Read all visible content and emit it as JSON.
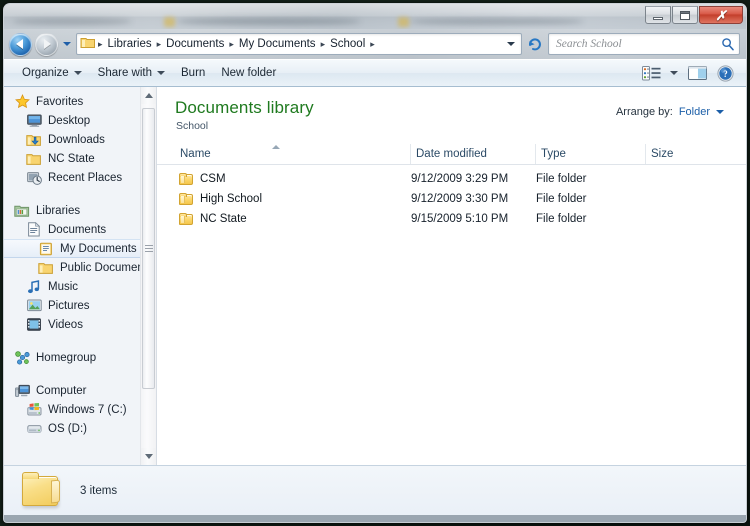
{
  "window": {
    "controls": {
      "minimize": "Minimize",
      "maximize": "Maximize",
      "close": "✗"
    }
  },
  "addressbar": {
    "back_tooltip": "Back",
    "forward_tooltip": "Forward",
    "history_tooltip": "Recent pages",
    "breadcrumb": [
      "Libraries",
      "Documents",
      "My Documents",
      "School"
    ],
    "separator": "▸",
    "refresh_tooltip": "Refresh"
  },
  "search": {
    "placeholder": "Search School",
    "value": ""
  },
  "toolbar": {
    "organize_label": "Organize",
    "share_with_label": "Share with",
    "burn_label": "Burn",
    "new_folder_label": "New folder",
    "change_view_tooltip": "Change your view",
    "preview_pane_tooltip": "Show the preview pane",
    "help_tooltip": "Get help"
  },
  "navpane": {
    "sections": [
      {
        "header": {
          "label": "Favorites",
          "icon": "star-icon"
        },
        "items": [
          {
            "label": "Desktop",
            "icon": "desktop-icon",
            "level": 1
          },
          {
            "label": "Downloads",
            "icon": "downloads-folder-icon",
            "level": 1
          },
          {
            "label": "NC State",
            "icon": "folder-icon",
            "level": 1
          },
          {
            "label": "Recent Places",
            "icon": "recent-places-icon",
            "level": 1
          }
        ]
      },
      {
        "header": {
          "label": "Libraries",
          "icon": "libraries-icon"
        },
        "items": [
          {
            "label": "Documents",
            "icon": "documents-library-icon",
            "level": 1
          },
          {
            "label": "My Documents",
            "icon": "my-documents-icon",
            "level": 2,
            "selected": true
          },
          {
            "label": "Public Documen",
            "icon": "folder-icon",
            "level": 2
          },
          {
            "label": "Music",
            "icon": "music-icon",
            "level": 1
          },
          {
            "label": "Pictures",
            "icon": "pictures-icon",
            "level": 1
          },
          {
            "label": "Videos",
            "icon": "videos-icon",
            "level": 1
          }
        ]
      },
      {
        "header": {
          "label": "Homegroup",
          "icon": "homegroup-icon"
        },
        "items": []
      },
      {
        "header": {
          "label": "Computer",
          "icon": "computer-icon"
        },
        "items": [
          {
            "label": "Windows 7 (C:)",
            "icon": "windows-drive-icon",
            "level": 1
          },
          {
            "label": "OS (D:)",
            "icon": "drive-icon",
            "level": 1
          }
        ]
      }
    ]
  },
  "content": {
    "library_title": "Documents library",
    "library_subtitle": "School",
    "arrange_by_label": "Arrange by:",
    "arrange_by_value": "Folder",
    "columns": [
      {
        "key": "name",
        "label": "Name",
        "sorted": "asc"
      },
      {
        "key": "date",
        "label": "Date modified"
      },
      {
        "key": "type",
        "label": "Type"
      },
      {
        "key": "size",
        "label": "Size"
      }
    ],
    "rows": [
      {
        "name": "CSM",
        "date": "9/12/2009 3:29 PM",
        "type": "File folder",
        "size": ""
      },
      {
        "name": "High School",
        "date": "9/12/2009 3:30 PM",
        "type": "File folder",
        "size": ""
      },
      {
        "name": "NC State",
        "date": "9/15/2009 5:10 PM",
        "type": "File folder",
        "size": ""
      }
    ]
  },
  "statusbar": {
    "item_count": "3 items",
    "icon": "folder-icon"
  },
  "colors": {
    "library_title_green": "#1f7a1f",
    "link_blue": "#1c5fa8",
    "column_header_text": "#2b4a66",
    "close_button_red": "#c33f2c"
  }
}
